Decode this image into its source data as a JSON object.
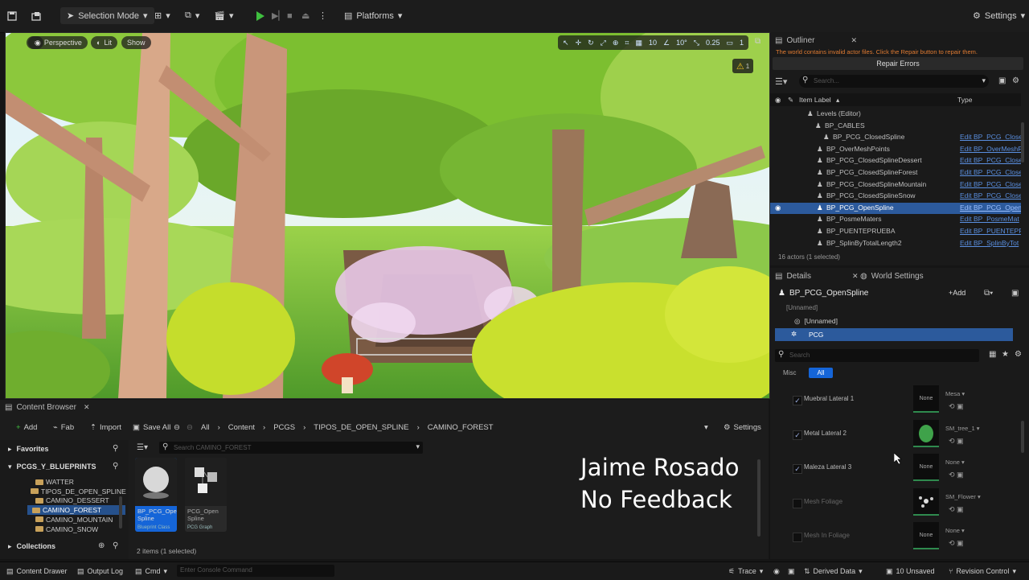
{
  "toolbar": {
    "selection_mode": "Selection Mode",
    "platforms": "Platforms",
    "settings": "Settings"
  },
  "viewport": {
    "perspective": "Perspective",
    "lit": "Lit",
    "show": "Show",
    "grid_snap": "10",
    "rotation_snap": "10°",
    "scale_snap": "0.25",
    "camera_speed": "1",
    "warning_count": "1"
  },
  "outliner": {
    "tab": "Outliner",
    "message": "The world contains invalid actor files. Click the Repair button to repair them.",
    "repair_button": "Repair Errors",
    "search_placeholder": "Search...",
    "col_item_label": "Item Label",
    "col_type": "Type",
    "rows": [
      {
        "name": "Levels (Editor)",
        "type": "",
        "indent": 58
      },
      {
        "name": "BP_CABLES",
        "type": "",
        "indent": 68
      },
      {
        "name": "BP_PCG_ClosedSpline",
        "type": "Edit BP_PCG_Close",
        "indent": 78
      },
      {
        "name": "BP_OverMeshPoints",
        "type": "Edit BP_OverMeshP",
        "indent": 70
      },
      {
        "name": "BP_PCG_ClosedSplineDessert",
        "type": "Edit BP_PCG_Close",
        "indent": 70
      },
      {
        "name": "BP_PCG_ClosedSplineForest",
        "type": "Edit BP_PCG_Close",
        "indent": 70
      },
      {
        "name": "BP_PCG_ClosedSplineMountain",
        "type": "Edit BP_PCG_Close",
        "indent": 70
      },
      {
        "name": "BP_PCG_ClosedSplineSnow",
        "type": "Edit BP_PCG_Close",
        "indent": 70
      },
      {
        "name": "BP_PCG_OpenSpline",
        "type": "Edit BP_PCG_Open",
        "indent": 70,
        "selected": true
      },
      {
        "name": "BP_PosmeMaters",
        "type": "Edit BP_PosmeMat",
        "indent": 70
      },
      {
        "name": "BP_PUENTEPRUEBA",
        "type": "Edit BP_PUENTEPR",
        "indent": 70
      },
      {
        "name": "BP_SplinByTotalLength2",
        "type": "Edit BP_SplinByTot",
        "indent": 70
      }
    ],
    "footer": "16 actors (1 selected)"
  },
  "details": {
    "tab": "Details",
    "tab2": "World Settings",
    "actor_name": "BP_PCG_OpenSpline",
    "add_button": "Add",
    "components": [
      "[Unnamed]",
      "[Unnamed]",
      "PCG"
    ],
    "search_placeholder": "Search",
    "filter_misc": "Misc",
    "filter_all": "All",
    "props": [
      {
        "label": "Muebral Lateral 1",
        "checked": true,
        "thumb": "None",
        "dd": "Mesa"
      },
      {
        "label": "Metal Lateral 2",
        "checked": true,
        "thumb": "",
        "dd": "SM_tree_1"
      },
      {
        "label": "Maleza Lateral 3",
        "checked": true,
        "thumb": "None",
        "dd": "None"
      },
      {
        "label": "Mesh Foliage",
        "checked": false,
        "thumb": "",
        "dd": "SM_Flower"
      },
      {
        "label": "Mesh In Foliage",
        "checked": false,
        "thumb": "None",
        "dd": "None"
      }
    ]
  },
  "content_browser": {
    "tab": "Content Browser",
    "add": "Add",
    "fab": "Fab",
    "import": "Import",
    "save_all": "Save All",
    "breadcrumb": [
      "All",
      "Content",
      "PCGS",
      "TIPOS_DE_OPEN_SPLINE",
      "CAMINO_FOREST"
    ],
    "settings": "Settings",
    "favorites": "Favorites",
    "root": "PCGS_Y_BLUEPRINTS",
    "search_placeholder": "Search CAMINO_FOREST",
    "folders": [
      "WATTER",
      "TIPOS_DE_OPEN_SPLINE",
      "CAMINO_DESSERT",
      "CAMINO_FOREST",
      "CAMINO_MOUNTAIN",
      "CAMINO_SNOW"
    ],
    "collections": "Collections",
    "assets": [
      {
        "name": "BP_PCG_Open Spline",
        "class": "Blueprint Class"
      },
      {
        "name": "PCG_Open Spline",
        "class": "PCG Graph"
      }
    ],
    "item_count": "2 items (1 selected)"
  },
  "status": {
    "content_drawer": "Content Drawer",
    "output_log": "Output Log",
    "cmd": "Cmd",
    "console_placeholder": "Enter Console Command",
    "trace": "Trace",
    "derived_data": "Derived Data",
    "unsaved": "10 Unsaved",
    "revision_control": "Revision Control"
  },
  "overlay": {
    "line1": "Jaime Rosado",
    "line2": "No Feedback"
  },
  "colors": {
    "accent": "#2c5a9c",
    "selection": "#1565d8",
    "play": "#3fbf3f"
  }
}
